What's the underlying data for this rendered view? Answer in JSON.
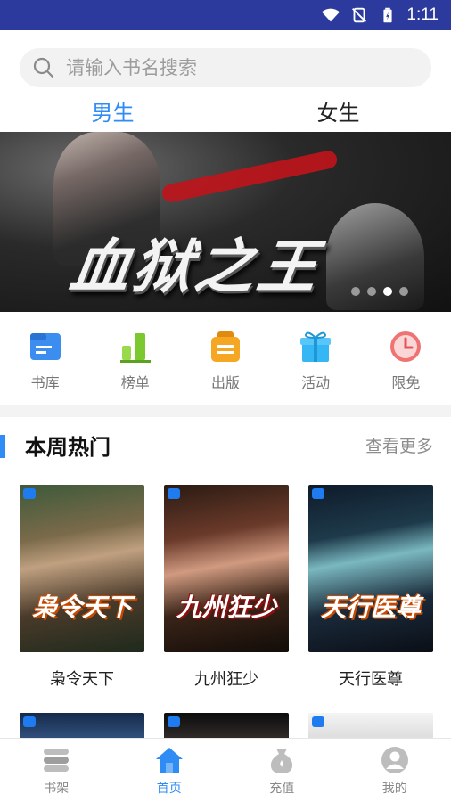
{
  "status": {
    "time": "1:11"
  },
  "search": {
    "placeholder": "请输入书名搜索"
  },
  "gender_tabs": {
    "male": "男生",
    "female": "女生",
    "active": "男生"
  },
  "banner": {
    "title": "血狱之王",
    "dot_count": 4,
    "active_dot": 1
  },
  "categories": [
    {
      "label": "书库",
      "icon": "library-icon",
      "color": "#3b8ef0"
    },
    {
      "label": "榜单",
      "icon": "ranking-icon",
      "color": "#7bc92f"
    },
    {
      "label": "出版",
      "icon": "publish-icon",
      "color": "#f5a623"
    },
    {
      "label": "活动",
      "icon": "gift-icon",
      "color": "#35b6f5"
    },
    {
      "label": "限免",
      "icon": "clock-icon",
      "color": "#f07373"
    }
  ],
  "section": {
    "title": "本周热门",
    "more": "查看更多"
  },
  "books": [
    {
      "title": "枭令天下",
      "cover_text": "枭令天下"
    },
    {
      "title": "九州狂少",
      "cover_text": "九州狂少"
    },
    {
      "title": "天行医尊",
      "cover_text": "天行医尊"
    }
  ],
  "tabbar": [
    {
      "label": "书架",
      "icon": "bookshelf-icon",
      "active": false
    },
    {
      "label": "首页",
      "icon": "home-icon",
      "active": true
    },
    {
      "label": "充值",
      "icon": "recharge-icon",
      "active": false
    },
    {
      "label": "我的",
      "icon": "profile-icon",
      "active": false
    }
  ],
  "colors": {
    "accent": "#2f8cf5",
    "status_bar": "#2b3a9c"
  }
}
